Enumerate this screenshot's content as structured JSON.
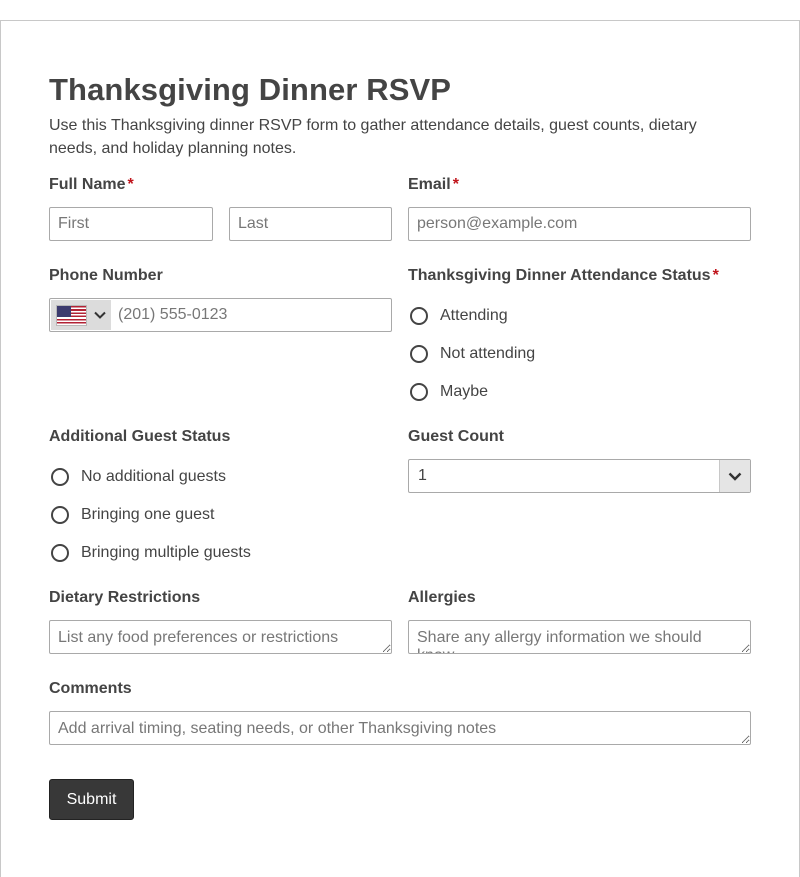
{
  "form": {
    "title": "Thanksgiving Dinner RSVP",
    "description": "Use this Thanksgiving dinner RSVP form to gather attendance details, guest counts, dietary needs, and holiday planning notes.",
    "required_marker": "*",
    "full_name": {
      "label": "Full Name",
      "first_placeholder": "First",
      "last_placeholder": "Last"
    },
    "email": {
      "label": "Email",
      "placeholder": "person@example.com"
    },
    "phone": {
      "label": "Phone Number",
      "placeholder": "(201) 555-0123",
      "country_flag": "us-flag-icon"
    },
    "attendance": {
      "label": "Thanksgiving Dinner Attendance Status",
      "options": [
        "Attending",
        "Not attending",
        "Maybe"
      ]
    },
    "additional_guests": {
      "label": "Additional Guest Status",
      "options": [
        "No additional guests",
        "Bringing one guest",
        "Bringing multiple guests"
      ]
    },
    "guest_count": {
      "label": "Guest Count",
      "value": "1"
    },
    "dietary": {
      "label": "Dietary Restrictions",
      "placeholder": "List any food preferences or restrictions"
    },
    "allergies": {
      "label": "Allergies",
      "placeholder": "Share any allergy information we should know"
    },
    "comments": {
      "label": "Comments",
      "placeholder": "Add arrival timing, seating needs, or other Thanksgiving notes"
    },
    "submit_label": "Submit"
  },
  "colors": {
    "text": "#444444",
    "required": "#c0141b",
    "button_bg": "#383838",
    "border": "#a9a9a9"
  }
}
